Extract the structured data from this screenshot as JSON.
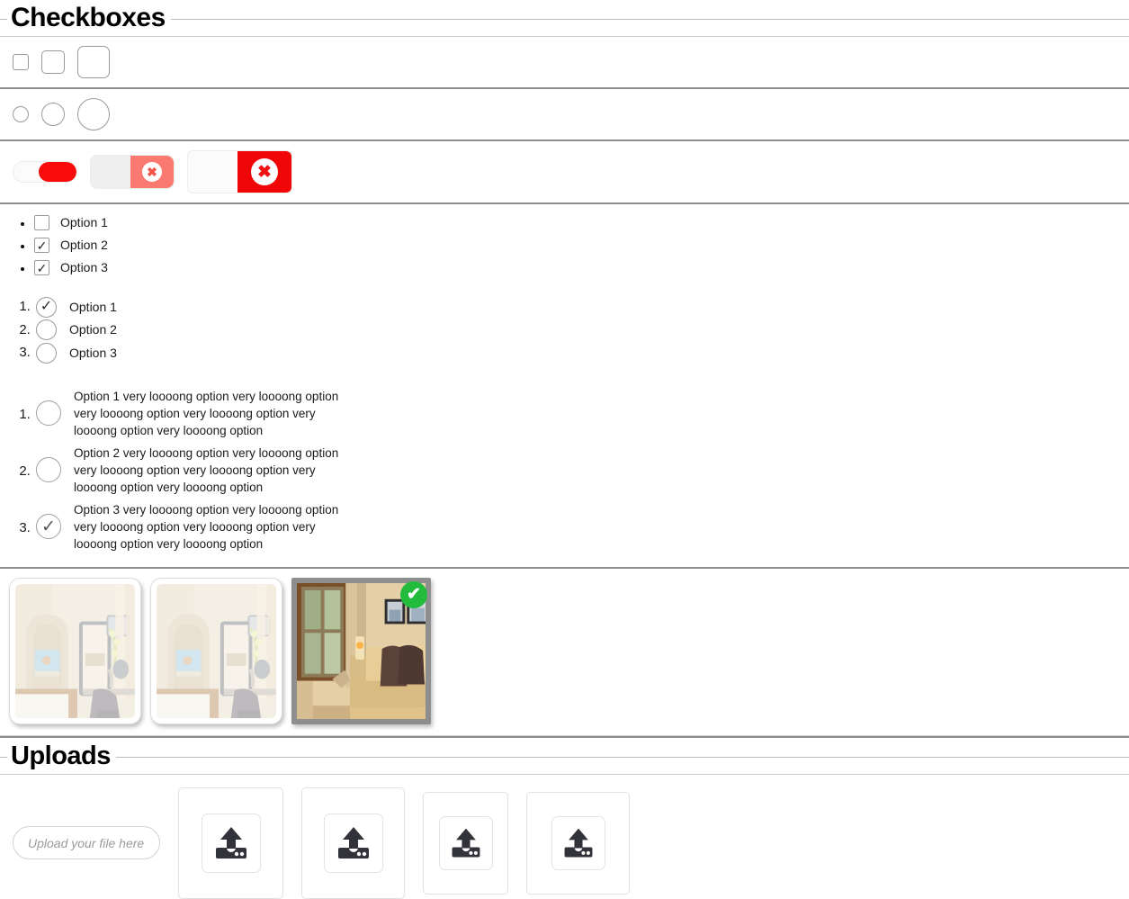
{
  "sections": {
    "checkboxes": {
      "title": "Checkboxes"
    },
    "uploads": {
      "title": "Uploads"
    }
  },
  "checkbox_sizes_row": {
    "name": "plain-checkboxes",
    "items": [
      {
        "size": "small",
        "checked": false,
        "glyph": ""
      },
      {
        "size": "medium",
        "checked": false,
        "glyph": ""
      },
      {
        "size": "large",
        "checked": false,
        "glyph": ""
      }
    ]
  },
  "radio_sizes_row": {
    "name": "plain-radios",
    "items": [
      {
        "size": "small",
        "checked": false
      },
      {
        "size": "medium",
        "checked": false
      },
      {
        "size": "large",
        "checked": false
      }
    ]
  },
  "toggles_row": {
    "name": "toggle-switches",
    "items": [
      {
        "size": "small",
        "state": "on",
        "knob_color": "#f80b0b",
        "track_color": "#fbfbfb",
        "icon": ""
      },
      {
        "size": "medium",
        "state": "on",
        "knob_color": "#fa7a72",
        "track_color": "#efefef",
        "icon": "✖"
      },
      {
        "size": "large",
        "state": "on",
        "knob_color": "#f00606",
        "track_color": "#fbfbfb",
        "icon": "✖"
      }
    ]
  },
  "checkbox_list": {
    "marker": "bullet",
    "check_glyph": "✓",
    "items": [
      {
        "label": "Option 1",
        "checked": false
      },
      {
        "label": "Option 2",
        "checked": true
      },
      {
        "label": "Option 3",
        "checked": true
      }
    ]
  },
  "radio_list": {
    "marker": "numbered",
    "check_glyph": "✓",
    "items": [
      {
        "label": "Option 1",
        "checked": true
      },
      {
        "label": "Option 2",
        "checked": false
      },
      {
        "label": "Option 3",
        "checked": false
      }
    ]
  },
  "radio_list_long": {
    "marker": "numbered",
    "check_glyph": "✓",
    "items": [
      {
        "label": "Option 1 very loooong option very loooong option very loooong option very loooong option very loooong option very loooong option",
        "checked": false
      },
      {
        "label": "Option 2 very loooong option very loooong option very loooong option very loooong option very loooong option very loooong option",
        "checked": false
      },
      {
        "label": "Option 3 very loooong option very loooong option very loooong option very loooong option very loooong option very loooong option",
        "checked": true
      }
    ]
  },
  "image_picker": {
    "selected_index": 2,
    "badge_glyph": "✔",
    "badge_color": "#22bb3c",
    "items": [
      {
        "alt": "bedroom-with-sea-view-thumbnail",
        "selected": false
      },
      {
        "alt": "bedroom-with-sea-view-thumbnail",
        "selected": false
      },
      {
        "alt": "living-room-with-sofa-thumbnail",
        "selected": true
      }
    ]
  },
  "uploads": {
    "file_input": {
      "value": "",
      "placeholder": "Upload your file here"
    },
    "buttons": [
      {
        "icon": "upload-icon",
        "label": ""
      },
      {
        "icon": "upload-icon",
        "label": ""
      },
      {
        "icon": "upload-icon",
        "label": ""
      },
      {
        "icon": "upload-icon",
        "label": ""
      }
    ]
  }
}
